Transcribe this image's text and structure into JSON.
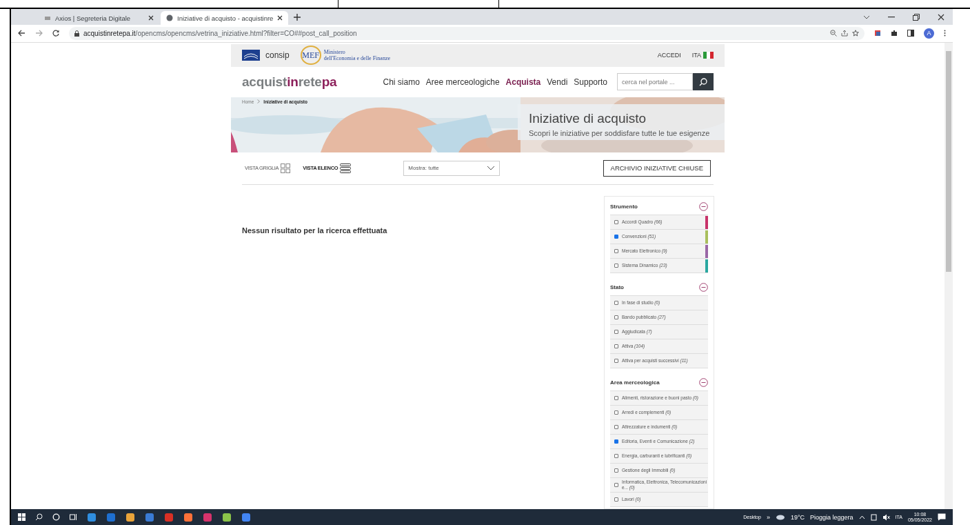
{
  "browser": {
    "tabs": [
      {
        "title": "Axios | Segreteria Digitale",
        "selected": false
      },
      {
        "title": "Iniziative di acquisto - acquistinre",
        "selected": true
      }
    ],
    "url": "**acquistinretepa.it**/opencms/opencms/vetrina_iniziative.html?filter=CO##post_call_position",
    "avatar": "A"
  },
  "topbar": {
    "consip": "consip",
    "mef": "MEF",
    "ministry_line1": "Ministero",
    "ministry_line2": "dell'Economia e delle Finanze",
    "login": "ACCEDI",
    "language": "ITA"
  },
  "header": {
    "logo": [
      {
        "text": "acquist",
        "accent": false
      },
      {
        "text": "in",
        "accent": true
      },
      {
        "text": "rete",
        "accent": false
      },
      {
        "text": "pa",
        "accent": true
      }
    ],
    "nav": [
      {
        "label": "Chi siamo",
        "selected": false
      },
      {
        "label": "Aree merceologiche",
        "selected": false
      },
      {
        "label": "Acquista",
        "selected": true
      },
      {
        "label": "Vendi",
        "selected": false
      },
      {
        "label": "Supporto",
        "selected": false
      }
    ],
    "search": {
      "placeholder": "cerca nel portale ..."
    }
  },
  "breadcrumb": [
    "Home",
    "Iniziative di acquisto"
  ],
  "banner": {
    "kind": "picture",
    "title": "Iniziative di acquisto",
    "subtitle": "Scopri le iniziative per soddisfare tutte le tue esigenze"
  },
  "toolbar": {
    "views": [
      {
        "label": "VISTA GRIGLIA",
        "kind": "grid",
        "selected": false
      },
      {
        "label": "VISTA ELENCO",
        "kind": "list",
        "selected": true
      }
    ],
    "filter": "Mostra: tutte",
    "archive_button": "ARCHIVIO INIZIATIVE CHIUSE"
  },
  "message": "Nessun risultato per la ricerca effettuata",
  "filters": [
    {
      "title": "Strumento",
      "expanded": true,
      "items": [
        {
          "label": "Accordi Quadro *(66)*",
          "checked": false,
          "color": "#c8336a"
        },
        {
          "label": "Convenzioni *(51)*",
          "checked": true,
          "color": "#a9bf5d"
        },
        {
          "label": "Mercato Elettronico *(9)*",
          "checked": false,
          "color": "#9a68a6"
        },
        {
          "label": "Sistema Dinamico *(23)*",
          "checked": false,
          "color": "#2aa7a0"
        }
      ]
    },
    {
      "title": "Stato",
      "expanded": true,
      "items": [
        {
          "label": "In fase di studio *(0)*",
          "checked": false
        },
        {
          "label": "Bando pubblicato *(27)*",
          "checked": false
        },
        {
          "label": "Aggiudicata *(7)*",
          "checked": false
        },
        {
          "label": "Attiva *(104)*",
          "checked": false
        },
        {
          "label": "Attiva per acquisti successivi *(11)*",
          "checked": false
        }
      ]
    },
    {
      "title": "Area merceologica",
      "expanded": true,
      "items": [
        {
          "label": "Alimenti, ristorazione e buoni pasto *(0)*",
          "checked": false
        },
        {
          "label": "Arredi e complementi *(0)*",
          "checked": false
        },
        {
          "label": "Attrezzature e indumenti *(0)*",
          "checked": false
        },
        {
          "label": "Editoria, Eventi e Comunicazione *(2)*",
          "checked": true
        },
        {
          "label": "Energia, carburanti e lubrificanti *(0)*",
          "checked": false
        },
        {
          "label": "Gestione degli Immobili *(0)*",
          "checked": false
        },
        {
          "label": "Informatica, Elettronica, Telecomunicazioni e... *(0)*",
          "checked": false
        },
        {
          "label": "Lavori *(0)*",
          "checked": false
        }
      ]
    }
  ],
  "taskbar": {
    "desktop": "Desktop",
    "more": "»",
    "temperature": "19°C",
    "weather": "Pioggia leggera",
    "language": "ITA",
    "time": "10:08",
    "date": "05/05/2022"
  }
}
